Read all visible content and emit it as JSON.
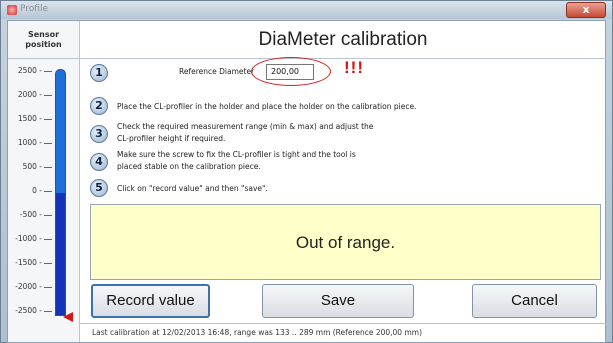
{
  "window": {
    "title": "Profile",
    "close_label": "x"
  },
  "sensor": {
    "header_line1": "Sensor",
    "header_line2": "position",
    "ticks": [
      "2500",
      "2000",
      "1500",
      "1000",
      "500",
      "0",
      "-500",
      "-1000",
      "-1500",
      "-2000",
      "-2500"
    ],
    "gauge_fill_fraction": 0.5,
    "gauge_color": "#1e6fd8",
    "gauge_fill_color": "#1533b6",
    "pointer_color": "#d11a1a"
  },
  "page": {
    "title": "DiaMeter calibration"
  },
  "steps": [
    {
      "num": "1",
      "text": "Reference Diameter"
    },
    {
      "num": "2",
      "text": "Place the CL-profiler in the holder and place the holder on the calibration piece."
    },
    {
      "num": "3",
      "line1": "Check the required measurement range (min & max) and adjust the",
      "line2": "CL-profiler height if required."
    },
    {
      "num": "4",
      "line1": "Make sure the screw to fix the CL-profiler is tight and the tool is",
      "line2": "placed stable on the calibration piece."
    },
    {
      "num": "5",
      "text": "Click on \"record value\" and then \"save\"."
    }
  ],
  "reference": {
    "value": "200,00",
    "alert": "!!!",
    "alert_color": "#e01010"
  },
  "message": {
    "text": "Out of range.",
    "background": "#ffffc9"
  },
  "buttons": {
    "record": "Record value",
    "save": "Save",
    "cancel": "Cancel"
  },
  "footer": {
    "text": "Last calibration at 12/02/2013 16:48, range was 133 .. 289 mm (Reference 200,00 mm)"
  }
}
